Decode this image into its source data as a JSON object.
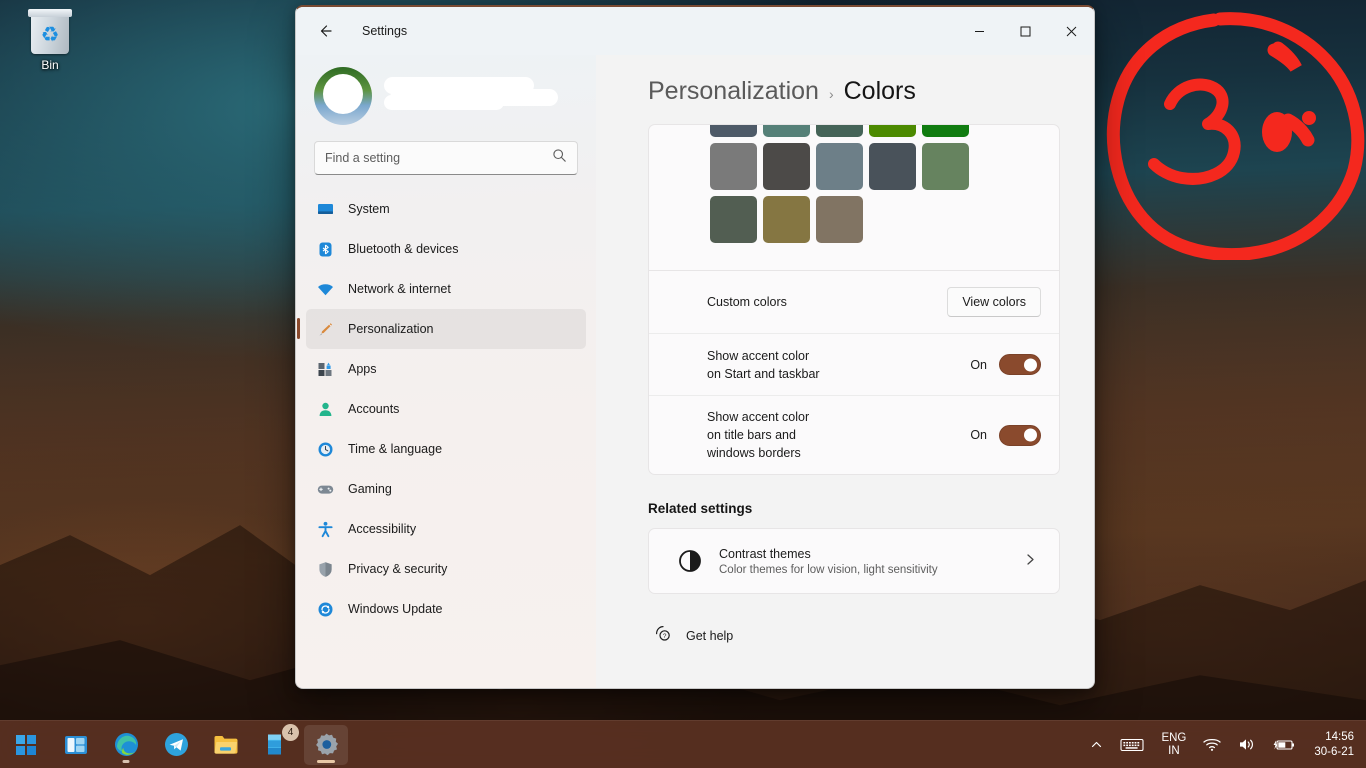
{
  "desktop": {
    "icons": [
      {
        "label": "Bin",
        "icon": "recycle-bin-icon"
      }
    ],
    "annotation": {
      "text": "3",
      "color": "#f4281e",
      "shape": "hand-drawn-circle"
    }
  },
  "window": {
    "titlebar": {
      "back_icon": "back-arrow-icon",
      "title": "Settings",
      "minimize_label": "—",
      "maximize_label": "☐",
      "close_label": "✕"
    },
    "sidebar": {
      "account": {
        "avatar": "user-avatar",
        "name_redacted": true
      },
      "search": {
        "placeholder": "Find a setting",
        "value": "",
        "icon": "search-icon"
      },
      "items": [
        {
          "label": "System",
          "icon": "monitor-icon",
          "active": false
        },
        {
          "label": "Bluetooth & devices",
          "icon": "bluetooth-icon",
          "active": false
        },
        {
          "label": "Network & internet",
          "icon": "wifi-icon",
          "active": false
        },
        {
          "label": "Personalization",
          "icon": "paintbrush-icon",
          "active": true
        },
        {
          "label": "Apps",
          "icon": "apps-icon",
          "active": false
        },
        {
          "label": "Accounts",
          "icon": "person-icon",
          "active": false
        },
        {
          "label": "Time & language",
          "icon": "clock-icon",
          "active": false
        },
        {
          "label": "Gaming",
          "icon": "gamepad-icon",
          "active": false
        },
        {
          "label": "Accessibility",
          "icon": "accessibility-icon",
          "active": false
        },
        {
          "label": "Privacy & security",
          "icon": "shield-icon",
          "active": false
        },
        {
          "label": "Windows Update",
          "icon": "update-icon",
          "active": false
        }
      ]
    },
    "content": {
      "breadcrumb": {
        "parent": "Personalization",
        "separator": "›",
        "current": "Colors"
      },
      "accent_swatches": {
        "row1_partial": [
          "#4e5a68",
          "#558078",
          "#456458",
          "#4c8a00",
          "#107c10"
        ],
        "row2": [
          "#7a7a7a",
          "#4c4a48",
          "#6d7f88",
          "#49525a",
          "#66835f"
        ],
        "row3": [
          "#525e52",
          "#857642",
          "#817463"
        ]
      },
      "rows": [
        {
          "name": "custom-colors",
          "label": "Custom colors",
          "control": "button",
          "button_label": "View colors"
        },
        {
          "name": "accent-start-taskbar",
          "label_lines": [
            "Show accent color",
            "on Start and taskbar"
          ],
          "control": "toggle",
          "state": "On",
          "on": true
        },
        {
          "name": "accent-titlebars",
          "label_lines": [
            "Show accent color",
            "on title bars and",
            "windows borders"
          ],
          "control": "toggle",
          "state": "On",
          "on": true
        }
      ],
      "related": {
        "section_title": "Related settings",
        "card": {
          "icon": "contrast-icon",
          "title": "Contrast themes",
          "subtitle": "Color themes for low vision, light sensitivity",
          "chevron": "chevron-right-icon"
        }
      },
      "get_help": {
        "label": "Get help",
        "icon": "help-icon"
      }
    },
    "accent_color": "#8a4a2d"
  },
  "taskbar": {
    "apps": [
      {
        "name": "start",
        "label": "Start",
        "badge": null,
        "state": "idle"
      },
      {
        "name": "task-view",
        "label": "Task view",
        "badge": null,
        "state": "idle"
      },
      {
        "name": "microsoft-edge",
        "label": "Microsoft Edge",
        "badge": null,
        "state": "running"
      },
      {
        "name": "telegram",
        "label": "Telegram",
        "badge": null,
        "state": "idle"
      },
      {
        "name": "file-explorer",
        "label": "File Explorer",
        "badge": null,
        "state": "idle"
      },
      {
        "name": "microsoft-store",
        "label": "Microsoft Store",
        "badge": "4",
        "state": "idle"
      },
      {
        "name": "settings",
        "label": "Settings",
        "badge": null,
        "state": "active"
      }
    ],
    "tray": {
      "overflow_icon": "chevron-up-icon",
      "keyboard_icon": "keyboard-icon",
      "language": {
        "line1": "ENG",
        "line2": "IN"
      },
      "network_icon": "wifi-icon",
      "volume_icon": "speaker-icon",
      "battery_icon": "battery-charging-icon",
      "clock": {
        "time": "14:56",
        "date": "30-6-21"
      }
    }
  }
}
